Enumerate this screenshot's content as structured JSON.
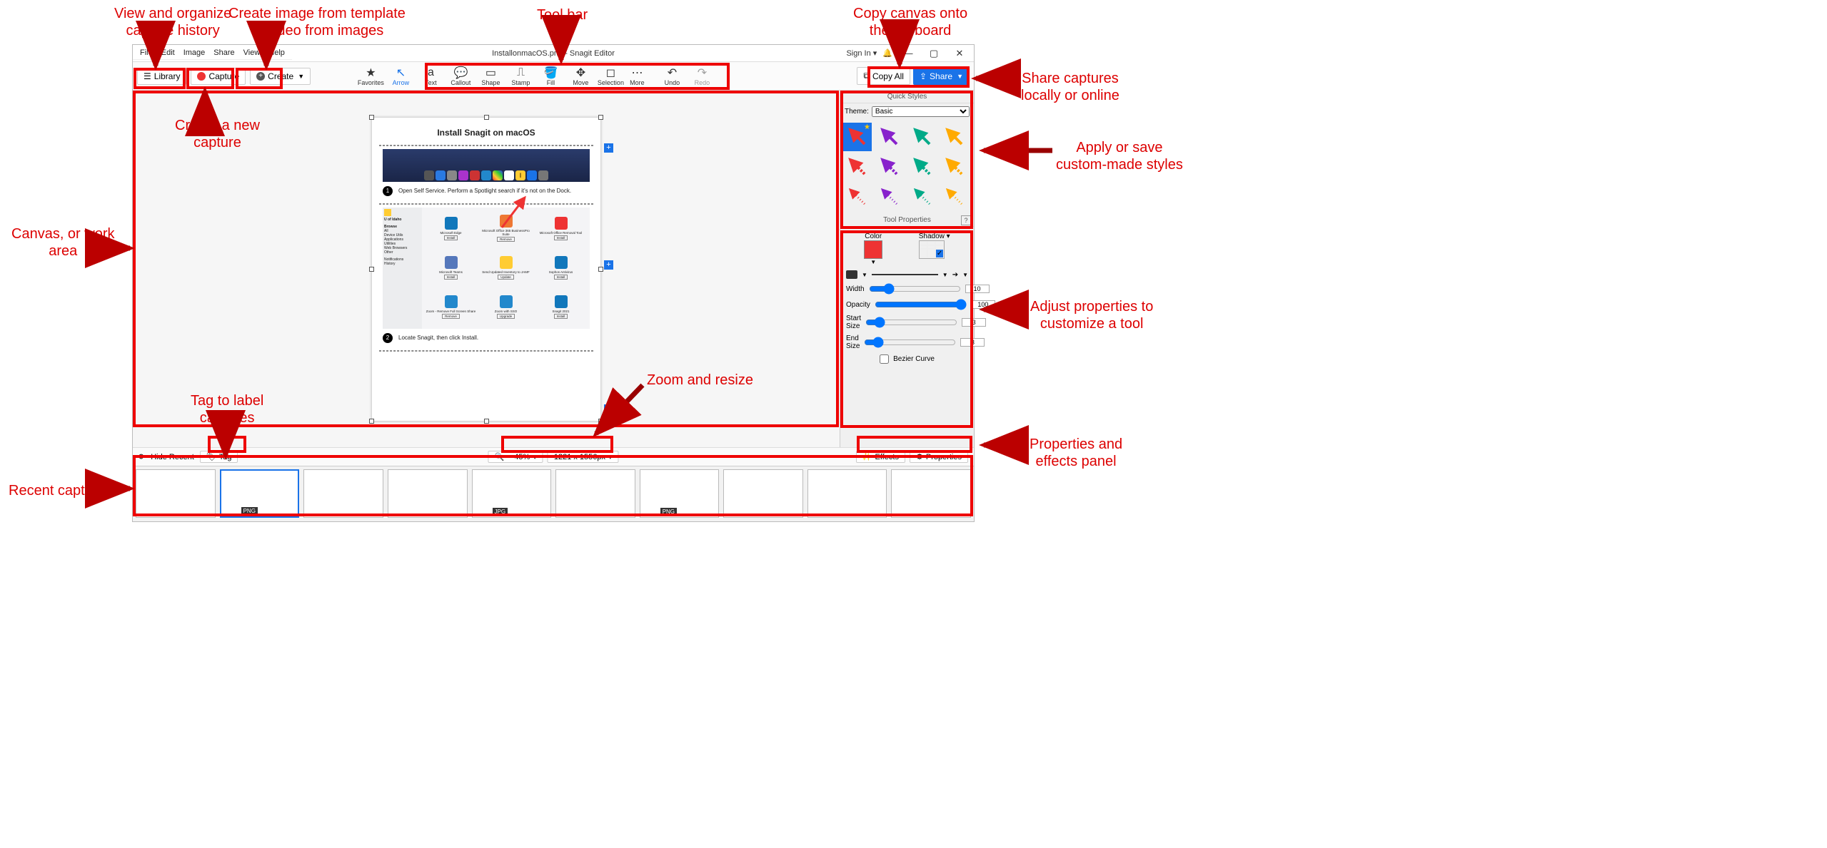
{
  "annotations": {
    "library": "View and organize\ncapture history",
    "create_btn": "Create image from template\nor video from images",
    "capture": "Create a new\ncapture",
    "toolbar": "Tool bar",
    "copy_all": "Copy canvas onto\nthe clipboard",
    "share": "Share captures\nlocally or online",
    "canvas": "Canvas, or work\narea",
    "quick_styles": "Apply or save\ncustom-made styles",
    "tool_props": "Adjust properties to\ncustomize a tool",
    "props_panel": "Properties and\neffects panel",
    "tag": "Tag to label\ncaptures",
    "zoom_resize": "Zoom and resize",
    "recent": "Recent captures"
  },
  "window": {
    "title": "InstallonmacOS.png - Snagit Editor",
    "sign_in": "Sign In",
    "menu": [
      "File",
      "Edit",
      "Image",
      "Share",
      "View",
      "Help"
    ]
  },
  "topbar": {
    "library": "Library",
    "capture": "Capture",
    "create": "Create",
    "copy_all": "Copy All",
    "share": "Share"
  },
  "tools": {
    "favorites": "Favorites",
    "arrow": "Arrow",
    "text": "Text",
    "callout": "Callout",
    "shape": "Shape",
    "stamp": "Stamp",
    "fill": "Fill",
    "move": "Move",
    "selection": "Selection",
    "more": "More",
    "undo": "Undo",
    "redo": "Redo"
  },
  "canvas_doc": {
    "title": "Install Snagit on macOS",
    "step1": "Open Self Service. Perform a Spotlight search if it's not on the Dock.",
    "step2": "Locate Snagit, then click Install.",
    "sidebar_header": "U of Idaho",
    "sidebar_browse": "Browse",
    "sidebar_items": [
      "All",
      "Device Utils",
      "Applications",
      "Utilities",
      "Web Browsers",
      "Other"
    ],
    "sidebar_notifications": "Notifications",
    "sidebar_history": "History",
    "apps": [
      "Microsoft Edge",
      "Microsoft Office 365 BusinessPro Suite",
      "Microsoft Office Removal Tool",
      "Microsoft Teams",
      "Send Updated Inventory to JAMF",
      "Sophos Antivirus",
      "Zoom - Remove Full Screen Share",
      "Zoom with SSO",
      "Snagit 2021"
    ],
    "app_buttons": [
      "Install",
      "Remove",
      "Install",
      "Install",
      "Update",
      "Install",
      "Remove",
      "Upgrade",
      "Install"
    ]
  },
  "quick_styles": {
    "header": "Quick Styles",
    "theme_label": "Theme:",
    "theme_value": "Basic"
  },
  "tool_properties": {
    "header": "Tool Properties",
    "color": "Color",
    "shadow": "Shadow",
    "width_label": "Width",
    "width_value": "10",
    "opacity_label": "Opacity",
    "opacity_value": "100",
    "start_label": "Start Size",
    "start_value": "3",
    "end_label": "End Size",
    "end_value": "3",
    "bezier": "Bezier Curve"
  },
  "status_bar": {
    "hide_recent": "Hide Recent",
    "tag": "Tag",
    "zoom": "45%",
    "dims": "1221 x 1556px",
    "effects": "Effects",
    "properties": "Properties"
  },
  "thumbnails": {
    "badges": [
      "",
      "PNG",
      "",
      "",
      "JPG",
      "",
      "PNG",
      "",
      "",
      "",
      ""
    ]
  }
}
